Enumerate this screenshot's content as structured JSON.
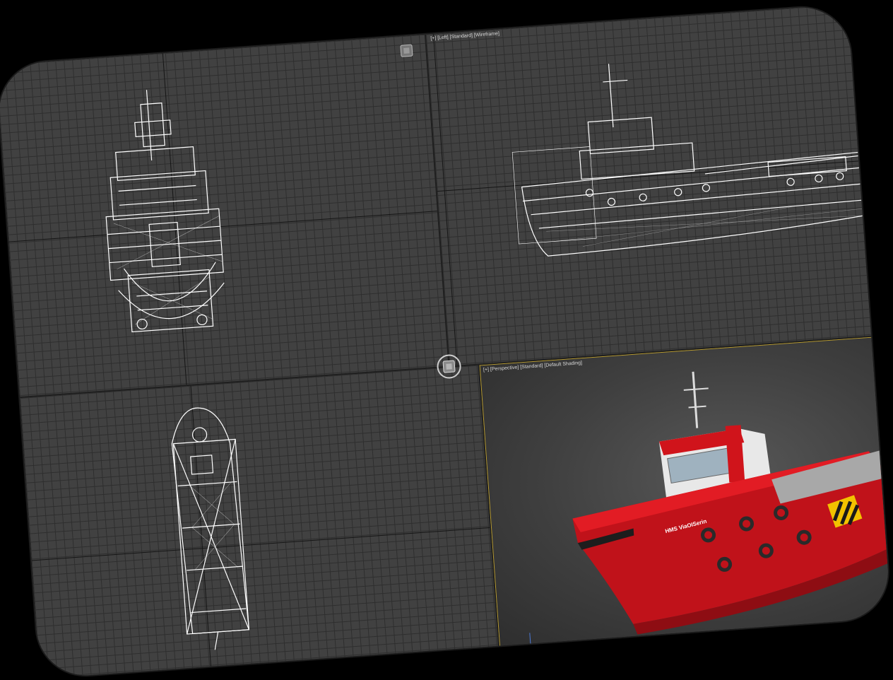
{
  "viewports": {
    "left": {
      "label": "[+] [Left] [Standard] [Wireframe]"
    },
    "perspective": {
      "label": "[+] [Perspective] [Standard] [Default Shading]"
    }
  },
  "ship": {
    "name_text": "HMS ViaOISerin",
    "hull_color": "#d0141b",
    "superstructure_color": "#e8e8e8",
    "hazard_colors": [
      "#f2c200",
      "#1a1a1a"
    ]
  },
  "icons": {
    "viewcube_top": "viewcube-icon",
    "viewcube_mid": "viewcube-icon",
    "axis_tripod": "axis-tripod-icon"
  }
}
